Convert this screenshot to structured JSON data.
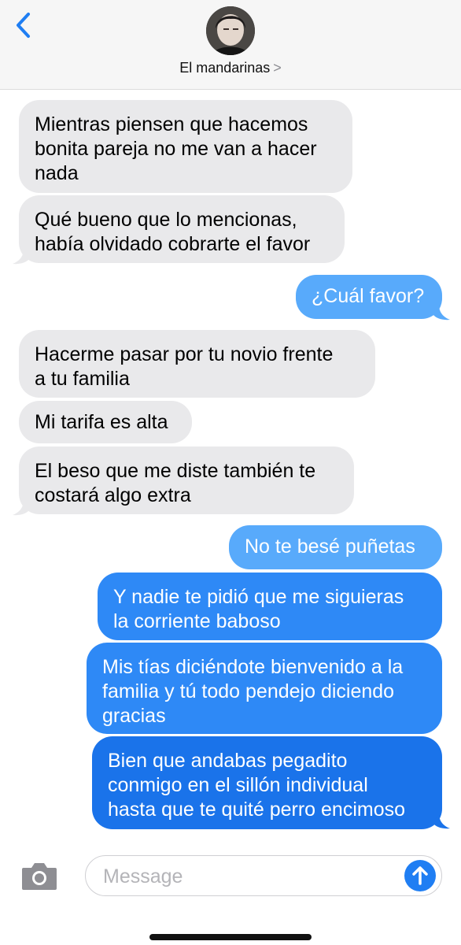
{
  "header": {
    "contact_name": "El mandarinas",
    "chevron": ">",
    "back_icon": "chevron-left-icon"
  },
  "messages": [
    {
      "side": "received",
      "text": "Mientras piensen que hacemos\nbonita pareja no me van a hacer\nnada"
    },
    {
      "side": "received",
      "text": "Qué bueno que lo mencionas,\nhabía olvidado cobrarte el favor"
    },
    {
      "side": "sent",
      "text": "¿Cuál favor?"
    },
    {
      "side": "received",
      "text": "Hacerme pasar por tu novio frente\na tu familia"
    },
    {
      "side": "received",
      "text": "Mi tarifa es alta"
    },
    {
      "side": "received",
      "text": "El beso que me diste también te\ncostará algo extra"
    },
    {
      "side": "sent",
      "text": "No te besé puñetas"
    },
    {
      "side": "sent",
      "text": "Y nadie te pidió que me siguieras\nla corriente baboso"
    },
    {
      "side": "sent",
      "text": "Mis tías diciéndote bienvenido a la\nfamilia y tú todo pendejo diciendo\ngracias"
    },
    {
      "side": "sent",
      "text": "Bien que andabas pegadito\nconmigo en el sillón individual\nhasta que te quité perro encimoso"
    }
  ],
  "input": {
    "placeholder": "Message",
    "camera_icon": "camera-icon",
    "send_icon": "arrow-up-icon"
  },
  "colors": {
    "received_bubble": "#e9e9eb",
    "sent_bubble": "#1f7ef3",
    "accent": "#1f7ef3"
  }
}
